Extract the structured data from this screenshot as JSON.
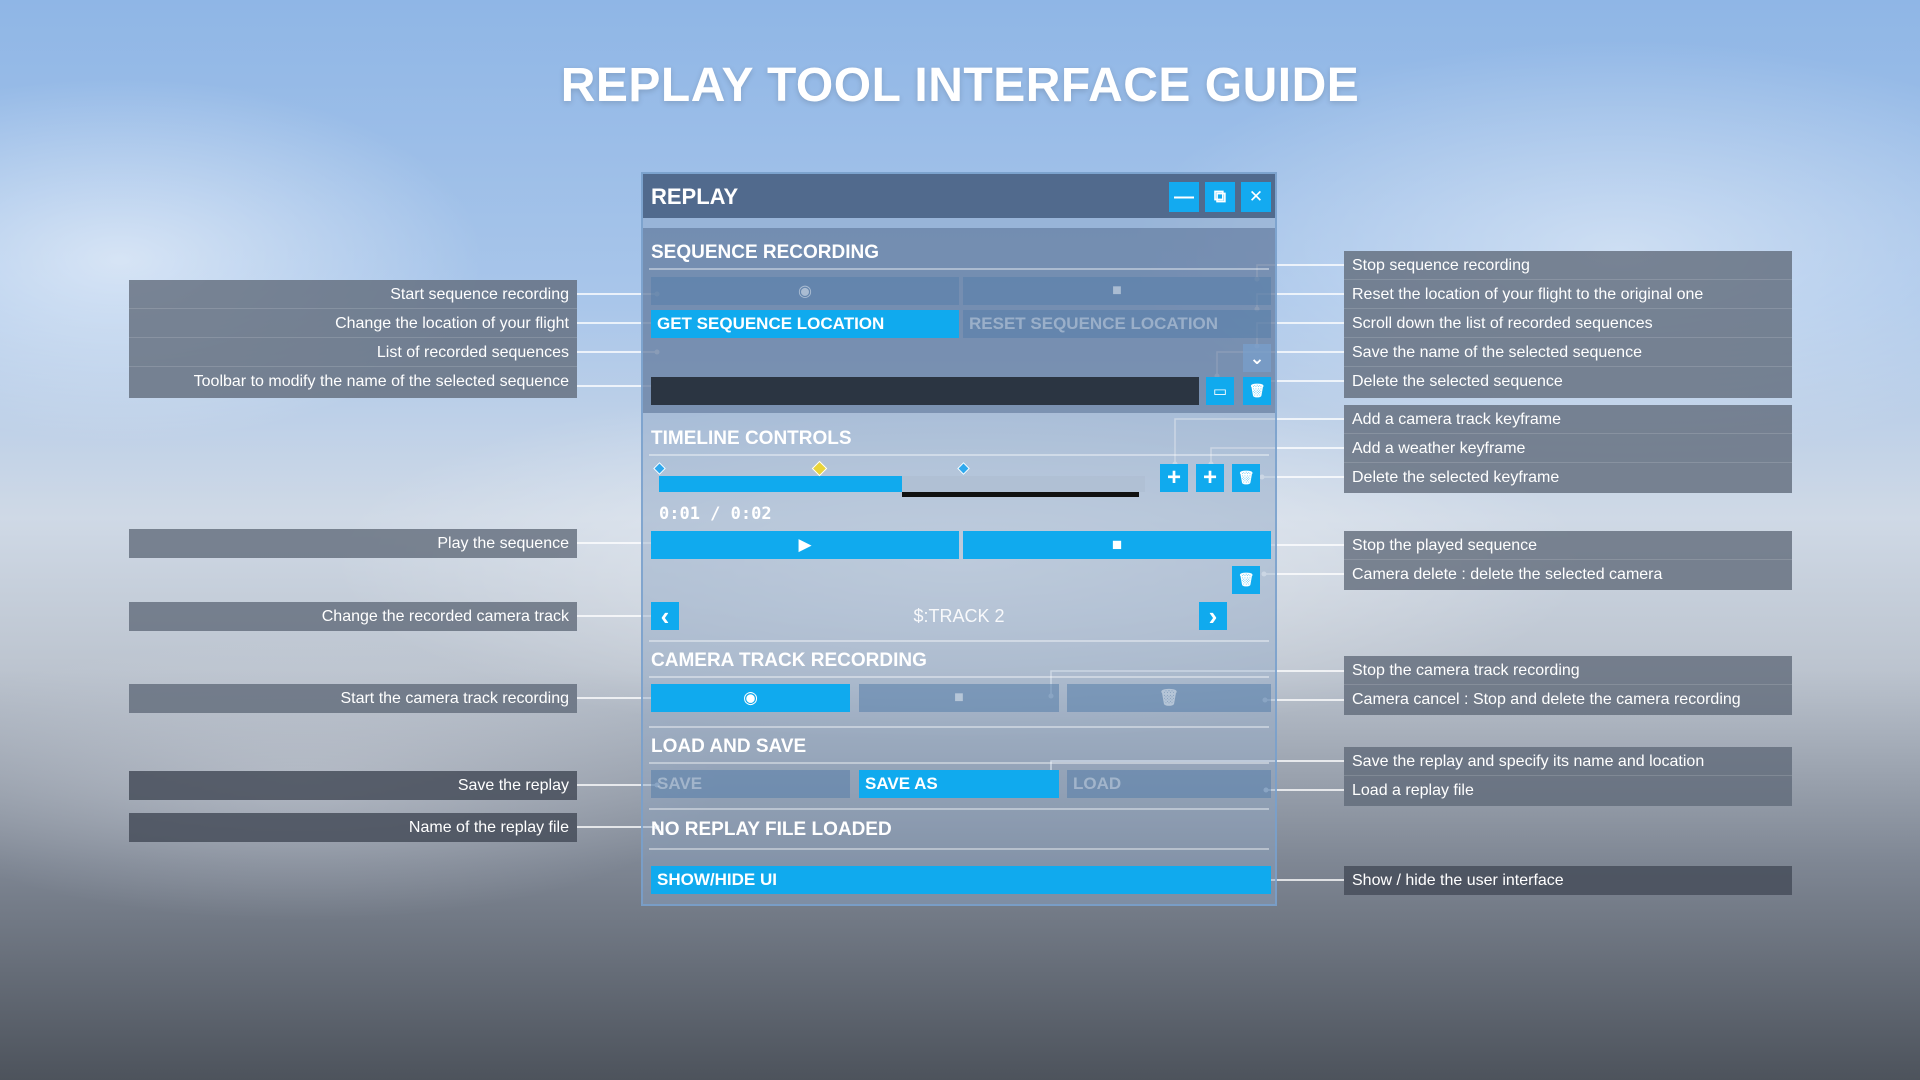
{
  "page_title": "REPLAY TOOL INTERFACE GUIDE",
  "panel": {
    "title": "REPLAY",
    "header_buttons": {
      "minimize": "—",
      "popout": "⧉",
      "close": "✕"
    },
    "sequence_recording": {
      "title": "SEQUENCE RECORDING",
      "record_icon": "◉",
      "stop_icon": "■",
      "get_location_label": "GET SEQUENCE LOCATION",
      "reset_location_label": "RESET SEQUENCE LOCATION",
      "scroll_icon": "⌄",
      "save_name_icon": "▭",
      "delete_icon": "🗑"
    },
    "timeline_controls": {
      "title": "TIMELINE CONTROLS",
      "time_display": "0:01 / 0:02",
      "progress": 0.5,
      "add_camera_key_icon": "+",
      "add_weather_key_icon": "+",
      "delete_key_icon": "🗑",
      "play_icon": "▶",
      "stop_icon": "■",
      "camera_delete_icon": "🗑",
      "prev_track_icon": "‹",
      "next_track_icon": "›",
      "track_name": "$:TRACK 2"
    },
    "camera_track_recording": {
      "title": "CAMERA TRACK RECORDING",
      "record_icon": "◉",
      "stop_icon": "■",
      "cancel_icon": "🗑"
    },
    "load_and_save": {
      "title": "LOAD AND SAVE",
      "save_label": "SAVE",
      "save_as_label": "SAVE AS",
      "load_label": "LOAD",
      "file_status": "NO REPLAY FILE LOADED"
    },
    "show_hide_label": "SHOW/HIDE UI"
  },
  "annotations_left": [
    "Start sequence recording",
    "Change the location of your flight",
    "List of recorded sequences",
    "Toolbar to modify the name of the selected sequence",
    "Play the sequence",
    "Change the recorded camera track",
    "Start the camera track recording",
    "Save the replay",
    "Name of the replay file"
  ],
  "annotations_right": [
    "Stop sequence recording",
    "Reset the location of your flight to the original one",
    "Scroll down the list of recorded sequences",
    "Save the name of the selected sequence",
    "Delete the selected sequence",
    "Add a camera track keyframe",
    "Add a weather keyframe",
    "Delete the selected keyframe",
    "Stop the played sequence",
    "Camera delete : delete the selected camera",
    "Stop the camera track recording",
    "Camera cancel : Stop and delete the camera recording",
    "Save the replay and specify its name and location",
    "Load a replay file",
    "Show / hide the user interface"
  ]
}
